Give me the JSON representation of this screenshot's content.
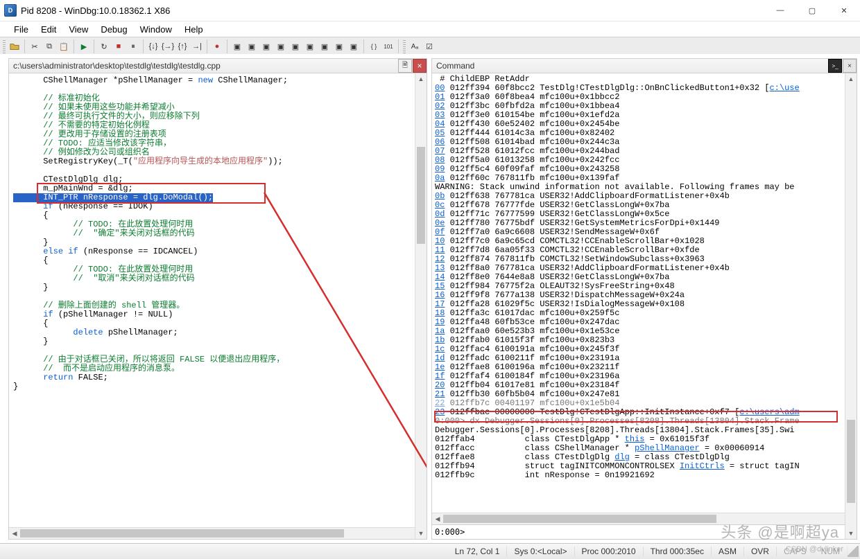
{
  "window": {
    "title": "Pid 8208 - WinDbg:10.0.18362.1 X86",
    "min_glyph": "—",
    "max_glyph": "▢",
    "close_glyph": "✕"
  },
  "menu": [
    "File",
    "Edit",
    "View",
    "Debug",
    "Window",
    "Help"
  ],
  "source_pane": {
    "title": "c:\\users\\administrator\\desktop\\testdlg\\testdlg\\testdlg.cpp"
  },
  "command_pane": {
    "title": "Command",
    "prompt": "0:000>"
  },
  "code_lines": [
    {
      "raw": "      CShellManager *pShellManager = ",
      "kw": "new",
      "tail": " CShellManager;"
    },
    {
      "blank": true
    },
    {
      "cm": "      // 标准初始化"
    },
    {
      "cm": "      // 如果未使用这些功能并希望减小"
    },
    {
      "cm": "      // 最终可执行文件的大小，则应移除下列"
    },
    {
      "cm": "      // 不需要的特定初始化例程"
    },
    {
      "cm": "      // 更改用于存储设置的注册表项"
    },
    {
      "cm": "      // TODO: 应适当修改该字符串，"
    },
    {
      "cm": "      // 例如修改为公司或组织名"
    },
    {
      "raw": "      SetRegistryKey(_T(",
      "str": "\"应用程序向导生成的本地应用程序\"",
      "tail": "));"
    },
    {
      "blank": true
    },
    {
      "raw": "      CTestDlgDlg dlg;"
    },
    {
      "raw": "      m_pMainWnd = &dlg;",
      "boxtop": true
    },
    {
      "sel": "      INT_PTR nResponse = dlg.DoModal();",
      "boxbottom": true
    },
    {
      "raw": "      ",
      "kw2": "if",
      "tail2": " (nResponse == IDOK)"
    },
    {
      "raw": "      {"
    },
    {
      "cm": "            // TODO: 在此放置处理何时用"
    },
    {
      "cm": "            //  \"确定\"来关闭对话框的代码"
    },
    {
      "raw": "      }"
    },
    {
      "raw": "      ",
      "kw2": "else if",
      "tail2": " (nResponse == IDCANCEL)"
    },
    {
      "raw": "      {"
    },
    {
      "cm": "            // TODO: 在此放置处理何时用"
    },
    {
      "cm": "            //  \"取消\"来关闭对话框的代码"
    },
    {
      "raw": "      }"
    },
    {
      "blank": true
    },
    {
      "cm": "      // 删除上面创建的 shell 管理器。"
    },
    {
      "raw": "      ",
      "kw2": "if",
      "tail2": " (pShellManager != NULL)"
    },
    {
      "raw": "      {"
    },
    {
      "raw": "            ",
      "kw2": "delete",
      "tail2": " pShellManager;"
    },
    {
      "raw": "      }"
    },
    {
      "blank": true
    },
    {
      "cm": "      // 由于对话框已关闭，所以将返回 FALSE 以便退出应用程序，"
    },
    {
      "cm": "      //  而不是启动应用程序的消息泵。"
    },
    {
      "raw": "      ",
      "kw2": "return",
      "tail2": " FALSE;"
    },
    {
      "raw": "}"
    }
  ],
  "cmd_header": " # ChildEBP RetAddr",
  "cmd_frames": [
    {
      "n": "00",
      "l": " 012ff394 60f8bcc2 TestDlg!CTestDlgDlg::OnBnClickedButton1+0x32 [",
      "link": "c:\\use"
    },
    {
      "n": "01",
      "l": " 012ff3a0 60f8bea4 mfc100u+0x1bbcc2"
    },
    {
      "n": "02",
      "l": " 012ff3bc 60fbfd2a mfc100u+0x1bbea4"
    },
    {
      "n": "03",
      "l": " 012ff3e0 610154be mfc100u+0x1efd2a"
    },
    {
      "n": "04",
      "l": " 012ff430 60e52402 mfc100u+0x2454be"
    },
    {
      "n": "05",
      "l": " 012ff444 61014c3a mfc100u+0x82402"
    },
    {
      "n": "06",
      "l": " 012ff508 61014bad mfc100u+0x244c3a"
    },
    {
      "n": "07",
      "l": " 012ff528 61012fcc mfc100u+0x244bad"
    },
    {
      "n": "08",
      "l": " 012ff5a0 61013258 mfc100u+0x242fcc"
    },
    {
      "n": "09",
      "l": " 012ff5c4 60f09faf mfc100u+0x243258"
    },
    {
      "n": "0a",
      "l": " 012ff60c 767811fb mfc100u+0x139faf"
    }
  ],
  "cmd_warning": "WARNING: Stack unwind information not available. Following frames may be",
  "cmd_frames2": [
    {
      "n": "0b",
      "l": " 012ff638 767781ca USER32!AddClipboardFormatListener+0x4b"
    },
    {
      "n": "0c",
      "l": " 012ff678 76777fde USER32!GetClassLongW+0x7ba"
    },
    {
      "n": "0d",
      "l": " 012ff71c 76777599 USER32!GetClassLongW+0x5ce"
    },
    {
      "n": "0e",
      "l": " 012ff780 76775bdf USER32!GetSystemMetricsForDpi+0x1449"
    },
    {
      "n": "0f",
      "l": " 012ff7a0 6a9c6608 USER32!SendMessageW+0x6f"
    },
    {
      "n": "10",
      "l": " 012ff7c0 6a9c65cd COMCTL32!CCEnableScrollBar+0x1028"
    },
    {
      "n": "11",
      "l": " 012ff7d8 6aa05f33 COMCTL32!CCEnableScrollBar+0xfde"
    },
    {
      "n": "12",
      "l": " 012ff874 767811fb COMCTL32!SetWindowSubclass+0x3963"
    },
    {
      "n": "13",
      "l": " 012ff8a0 767781ca USER32!AddClipboardFormatListener+0x4b"
    },
    {
      "n": "14",
      "l": " 012ff8e0 7644e8a8 USER32!GetClassLongW+0x7ba"
    },
    {
      "n": "15",
      "l": " 012ff984 76775f2a OLEAUT32!SysFreeString+0x48"
    },
    {
      "n": "16",
      "l": " 012ff9f8 7677a138 USER32!DispatchMessageW+0x24a"
    },
    {
      "n": "17",
      "l": " 012ffa28 61029f5c USER32!IsDialogMessageW+0x108"
    },
    {
      "n": "18",
      "l": " 012ffa3c 61017dac mfc100u+0x259f5c"
    },
    {
      "n": "19",
      "l": " 012ffa48 60fb53ce mfc100u+0x247dac"
    },
    {
      "n": "1a",
      "l": " 012ffaa0 60e523b3 mfc100u+0x1e53ce"
    },
    {
      "n": "1b",
      "l": " 012ffab0 61015f3f mfc100u+0x823b3"
    },
    {
      "n": "1c",
      "l": " 012ffac4 6100191a mfc100u+0x245f3f"
    },
    {
      "n": "1d",
      "l": " 012ffadc 6100211f mfc100u+0x23191a"
    },
    {
      "n": "1e",
      "l": " 012ffae8 6100196a mfc100u+0x23211f"
    },
    {
      "n": "1f",
      "l": " 012ffaf4 6100184f mfc100u+0x23196a"
    },
    {
      "n": "20",
      "l": " 012ffb04 61017e81 mfc100u+0x23184f"
    },
    {
      "n": "21",
      "l": " 012ffb30 60fb5b04 mfc100u+0x247e81"
    },
    {
      "n": "22",
      "l": " 012ffb7c 00401197 mfc100u+0x1e5b04",
      "dim": true
    },
    {
      "n": "23",
      "l": " 012ffbac 00000000 TestDlg!CTestDlgApp::InitInstance+0xf7 [",
      "link": "c:\\users\\adm",
      "box": true
    }
  ],
  "cmd_tail": [
    "0:000> dx Debugger.Sessions[0].Processes[8208].Threads[13804].Stack.Frame",
    "Debugger.Sessions[0].Processes[8208].Threads[13804].Stack.Frames[35].Swi"
  ],
  "locals": [
    {
      "addr": "012ffab4",
      "body": "          class CTestDlgApp * ",
      "link": "this",
      "tail": " = 0x61015f3f"
    },
    {
      "addr": "012ffacc",
      "body": "          class CShellManager * ",
      "link": "pShellManager",
      "tail": " = 0x00060914"
    },
    {
      "addr": "012ffae8",
      "body": "          class CTestDlgDlg ",
      "link": "dlg",
      "tail": " = class CTestDlgDlg"
    },
    {
      "addr": "012ffb94",
      "body": "          struct tagINITCOMMONCONTROLSEX ",
      "link": "InitCtrls",
      "tail": " = struct tagIN"
    },
    {
      "addr": "012ffb9c",
      "body": "          int nResponse = 0n19921692"
    }
  ],
  "status": {
    "lncol": "Ln 72, Col 1",
    "sys": "Sys 0:<Local>",
    "proc": "Proc 000:2010",
    "thrd": "Thrd 000:35ec",
    "asm": "ASM",
    "ovr": "OVR",
    "caps": "CAPS",
    "num": "NUM"
  },
  "watermark": "头条 @是啊超ya",
  "watermark2": "CSDN @dvlinker"
}
